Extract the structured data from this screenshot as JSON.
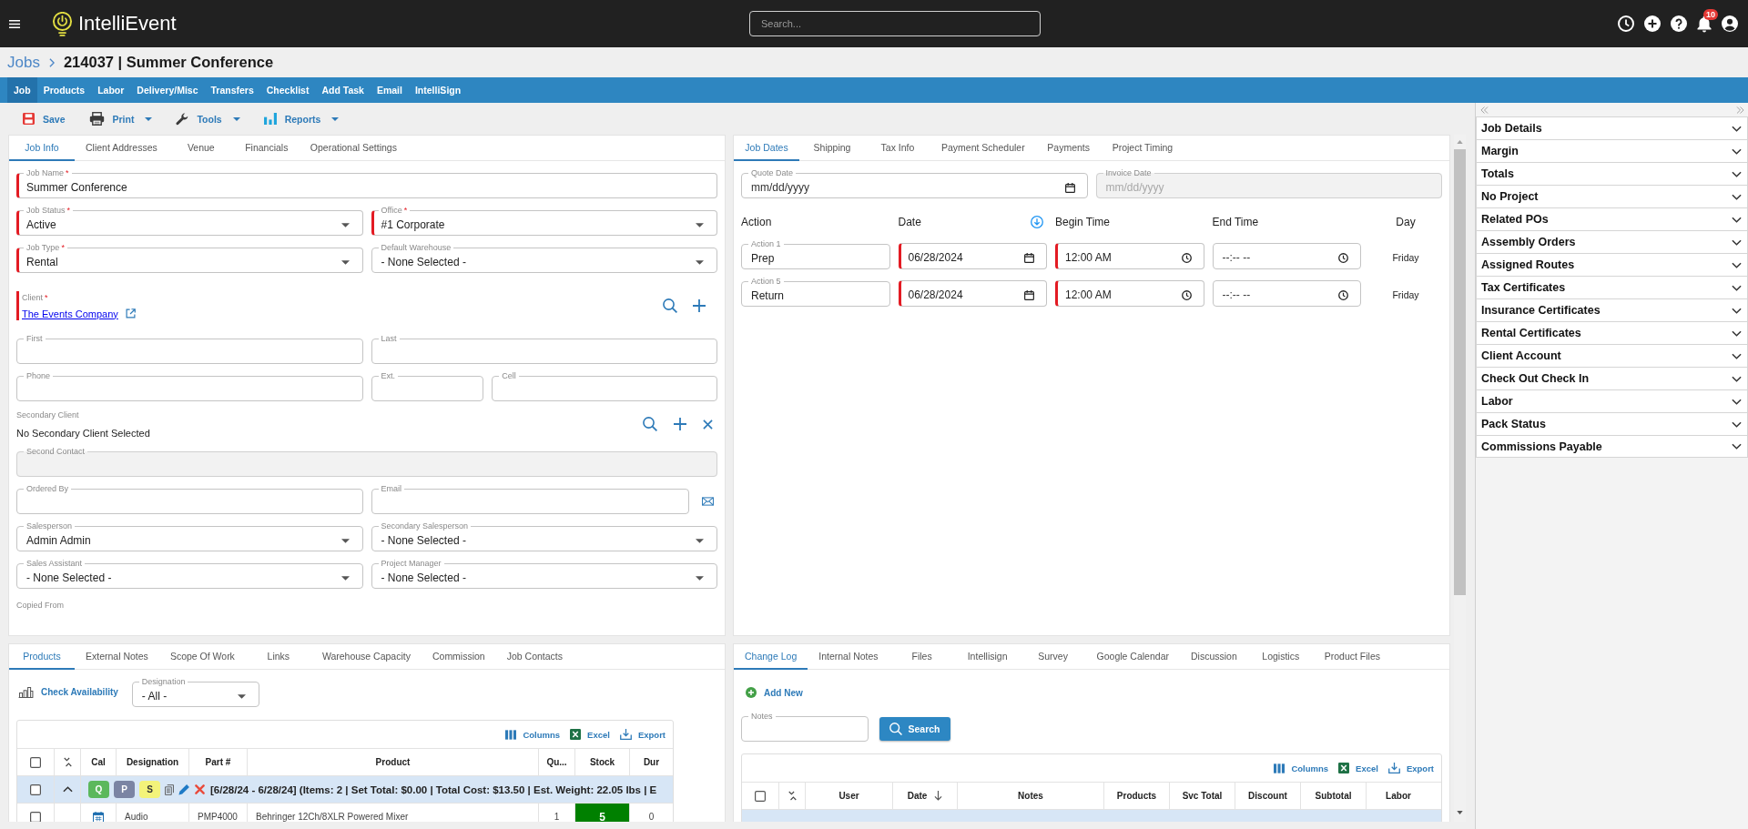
{
  "header": {
    "app_name": "IntelliEvent",
    "search": {
      "placeholder": "Search..."
    },
    "notification_count": "10"
  },
  "breadcrumb": {
    "parent": "Jobs",
    "title": "214037 | Summer Conference"
  },
  "nav": [
    {
      "label": "Job",
      "selected": true
    },
    {
      "label": "Products",
      "selected": false
    },
    {
      "label": "Labor",
      "selected": false
    },
    {
      "label": "Delivery/Misc",
      "selected": false
    },
    {
      "label": "Transfers",
      "selected": false
    },
    {
      "label": "Checklist",
      "selected": false
    },
    {
      "label": "Add Task",
      "selected": false
    },
    {
      "label": "Email",
      "selected": false
    },
    {
      "label": "IntelliSign",
      "selected": false
    }
  ],
  "toolbar": [
    {
      "label": "Save",
      "kind": "save",
      "menu": false
    },
    {
      "label": "Print",
      "kind": "print",
      "menu": true
    },
    {
      "label": "Tools",
      "kind": "tools",
      "menu": true
    },
    {
      "label": "Reports",
      "kind": "reports",
      "menu": true
    }
  ],
  "job_info": {
    "tabs": [
      {
        "label": "Job Info",
        "selected": true
      },
      {
        "label": "Client Addresses",
        "selected": false
      },
      {
        "label": "Venue",
        "selected": false
      },
      {
        "label": "Financials",
        "selected": false
      },
      {
        "label": "Operational Settings",
        "selected": false
      }
    ],
    "form": [
      {
        "kind": "fields",
        "fields": [
          {
            "label": "Job Name",
            "mark": "*",
            "value": "Summer Conference",
            "kind": "text",
            "required": true,
            "disabled": false
          }
        ]
      },
      {
        "kind": "fields",
        "fields": [
          {
            "label": "Job Status",
            "mark": "*",
            "value": "Active",
            "kind": "select",
            "required": true,
            "disabled": false
          },
          {
            "label": "Office",
            "mark": "*",
            "value": "#1 Corporate",
            "kind": "select",
            "required": true,
            "disabled": false
          }
        ]
      },
      {
        "kind": "fields",
        "fields": [
          {
            "label": "Job Type",
            "mark": "*",
            "value": "Rental",
            "kind": "select",
            "required": true,
            "disabled": false
          },
          {
            "label": "Default Warehouse",
            "value": "- None Selected -",
            "kind": "select",
            "required": false,
            "disabled": false
          }
        ]
      },
      {
        "kind": "client",
        "label": "Client",
        "mark": "*",
        "required": true,
        "link": "The Events Company"
      },
      {
        "kind": "fields",
        "fields": [
          {
            "label": "First",
            "kind": "text",
            "required": false,
            "disabled": false
          },
          {
            "label": "Last",
            "kind": "text",
            "required": false,
            "disabled": false
          }
        ]
      },
      {
        "kind": "fields",
        "fields": [
          {
            "label": "Phone",
            "kind": "text",
            "required": false,
            "disabled": false
          },
          {
            "label": "Ext.",
            "kind": "text",
            "required": false,
            "disabled": false
          },
          {
            "label": "Cell",
            "kind": "text",
            "required": false,
            "disabled": false
          }
        ]
      },
      {
        "kind": "secondary_client",
        "label": "Secondary Client",
        "value": "No Secondary Client Selected"
      },
      {
        "kind": "fields",
        "fields": [
          {
            "label": "Second Contact",
            "kind": "text",
            "required": false,
            "disabled": true
          }
        ]
      },
      {
        "kind": "fields",
        "fields": [
          {
            "label": "Ordered By",
            "kind": "text",
            "required": false,
            "disabled": false
          },
          {
            "label": "Email",
            "kind": "email",
            "required": false,
            "disabled": false
          }
        ]
      },
      {
        "kind": "fields",
        "fields": [
          {
            "label": "Salesperson",
            "value": "Admin Admin",
            "kind": "select",
            "required": false,
            "disabled": false
          },
          {
            "label": "Secondary Salesperson",
            "value": "- None Selected -",
            "kind": "select",
            "required": false,
            "disabled": false
          }
        ]
      },
      {
        "kind": "fields",
        "fields": [
          {
            "label": "Sales Assistant",
            "value": "- None Selected -",
            "kind": "select",
            "required": false,
            "disabled": false
          },
          {
            "label": "Project Manager",
            "value": "- None Selected -",
            "kind": "select",
            "required": false,
            "disabled": false
          }
        ]
      },
      {
        "kind": "label",
        "label": "Copied From"
      }
    ]
  },
  "job_dates": {
    "tabs": [
      {
        "label": "Job Dates",
        "selected": true
      },
      {
        "label": "Shipping",
        "selected": false
      },
      {
        "label": "Tax Info",
        "selected": false
      },
      {
        "label": "Payment Scheduler",
        "selected": false
      },
      {
        "label": "Payments",
        "selected": false
      },
      {
        "label": "Project Timing",
        "selected": false
      }
    ],
    "dates": [
      {
        "label": "Quote Date",
        "placeholder": "mm/dd/yyyy",
        "kind": "date",
        "required": false,
        "disabled": false
      },
      {
        "label": "Invoice Date",
        "placeholder": "mm/dd/yyyy",
        "kind": "text",
        "required": false,
        "disabled": true
      }
    ],
    "columns": [
      {
        "label": "Action",
        "kind": "text"
      },
      {
        "label": "Date",
        "kind": "action"
      },
      {
        "label": "Begin Time",
        "kind": "text"
      },
      {
        "label": "End Time",
        "kind": "text"
      },
      {
        "label": "Day",
        "kind": "text"
      }
    ],
    "rows": [
      {
        "action": {
          "label": "Action 1",
          "value": "Prep",
          "kind": "text",
          "required": false,
          "disabled": false
        },
        "date": {
          "value": "06/28/2024",
          "kind": "date",
          "required": true,
          "disabled": false
        },
        "begin": {
          "value": "12:00 AM",
          "kind": "time",
          "required": true,
          "disabled": false
        },
        "end": {
          "placeholder": "--:-- --",
          "kind": "time",
          "required": false,
          "disabled": false
        },
        "day": "Friday"
      },
      {
        "action": {
          "label": "Action 5",
          "value": "Return",
          "kind": "text",
          "required": false,
          "disabled": false
        },
        "date": {
          "value": "06/28/2024",
          "kind": "date",
          "required": true,
          "disabled": false
        },
        "begin": {
          "value": "12:00 AM",
          "kind": "time",
          "required": true,
          "disabled": false
        },
        "end": {
          "placeholder": "--:-- --",
          "kind": "time",
          "required": false,
          "disabled": false
        },
        "day": "Friday"
      }
    ]
  },
  "products": {
    "tabs": [
      {
        "label": "Products",
        "selected": true
      },
      {
        "label": "External Notes",
        "selected": false
      },
      {
        "label": "Scope Of Work",
        "selected": false
      },
      {
        "label": "Links",
        "selected": false
      },
      {
        "label": "Warehouse Capacity",
        "selected": false
      },
      {
        "label": "Commission",
        "selected": false
      },
      {
        "label": "Job Contacts",
        "selected": false
      }
    ],
    "availability": "Check Availability",
    "designation": {
      "label": "Designation",
      "value": "- All -",
      "kind": "select",
      "required": false,
      "disabled": false
    },
    "grid": {
      "tools": [
        {
          "label": "Columns",
          "kind": "columns"
        },
        {
          "label": "Excel",
          "kind": "excel"
        },
        {
          "label": "Export",
          "kind": "export"
        }
      ],
      "checked": false,
      "columns": [
        {
          "label": "Cal",
          "sorted": false
        },
        {
          "label": "Designation",
          "sorted": false
        },
        {
          "label": "Part #",
          "sorted": false
        },
        {
          "label": "Product",
          "sorted": false
        },
        {
          "label": "Qu...",
          "sorted": false
        },
        {
          "label": "Stock",
          "sorted": false
        },
        {
          "label": "Dur",
          "sorted": false
        }
      ],
      "groups": [
        {
          "checked": false,
          "expanded": true,
          "badges": [
            {
              "label": "Q",
              "color": "#5cb85c"
            },
            {
              "label": "P",
              "color": "#7b84a3"
            },
            {
              "label": "S",
              "color": "#f3f37a"
            }
          ],
          "summary": "[6/28/24 - 6/28/24] (Items: 2 | Set Total: $0.00 | Total Cost: $13.50 | Est. Weight: 22.05 lbs | E",
          "rows": [
            {
              "checked": false,
              "designation": "Audio",
              "part": "PMP4000",
              "product": "Behringer 12Ch/8XLR Powered Mixer",
              "quantity": "1",
              "stock": "5",
              "color": "#008000",
              "duration": "0"
            }
          ]
        }
      ]
    }
  },
  "change_log": {
    "tabs": [
      {
        "label": "Change Log",
        "selected": true
      },
      {
        "label": "Internal Notes",
        "selected": false
      },
      {
        "label": "Files",
        "selected": false
      },
      {
        "label": "Intellisign",
        "selected": false
      },
      {
        "label": "Survey",
        "selected": false
      },
      {
        "label": "Google Calendar",
        "selected": false
      },
      {
        "label": "Discussion",
        "selected": false
      },
      {
        "label": "Logistics",
        "selected": false
      },
      {
        "label": "Product Files",
        "selected": false
      }
    ],
    "add_new": "Add New",
    "notes": {
      "label": "Notes",
      "kind": "text",
      "required": false,
      "disabled": false
    },
    "search_button": "Search",
    "grid": {
      "tools": [
        {
          "label": "Columns",
          "kind": "columns"
        },
        {
          "label": "Excel",
          "kind": "excel"
        },
        {
          "label": "Export",
          "kind": "export"
        }
      ],
      "checked": false,
      "columns": [
        {
          "label": "User",
          "sorted": false
        },
        {
          "label": "Date",
          "sorted": true
        },
        {
          "label": "Notes",
          "sorted": false
        },
        {
          "label": "Products",
          "sorted": false
        },
        {
          "label": "Svc Total",
          "sorted": false
        },
        {
          "label": "Discount",
          "sorted": false
        },
        {
          "label": "Subtotal",
          "sorted": false
        },
        {
          "label": "Labor",
          "sorted": false
        }
      ]
    }
  },
  "sidebar": {
    "items": [
      {
        "label": "Job Details",
        "expanded": false
      },
      {
        "label": "Margin",
        "expanded": false
      },
      {
        "label": "Totals",
        "expanded": false
      },
      {
        "label": "No Project",
        "expanded": false
      },
      {
        "label": "Related POs",
        "expanded": false
      },
      {
        "label": "Assembly Orders",
        "expanded": false
      },
      {
        "label": "Assigned Routes",
        "expanded": false
      },
      {
        "label": "Tax Certificates",
        "expanded": false
      },
      {
        "label": "Insurance Certificates",
        "expanded": false
      },
      {
        "label": "Rental Certificates",
        "expanded": false
      },
      {
        "label": "Client Account",
        "expanded": false
      },
      {
        "label": "Check Out Check In",
        "expanded": false
      },
      {
        "label": "Labor",
        "expanded": false
      },
      {
        "label": "Pack Status",
        "expanded": false
      },
      {
        "label": "Commissions Payable",
        "expanded": false
      }
    ]
  }
}
